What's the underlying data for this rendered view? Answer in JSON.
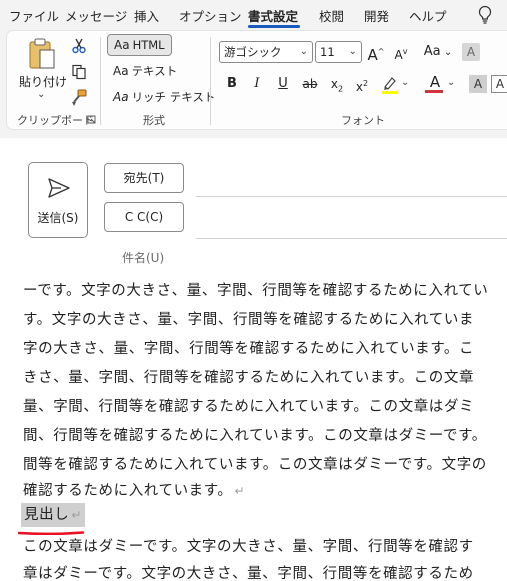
{
  "menu": {
    "tabs": [
      "ファイル",
      "メッセージ",
      "挿入",
      "オプション",
      "書式設定",
      "校閲",
      "開発",
      "ヘルプ"
    ],
    "active_tab": "書式設定"
  },
  "ribbon": {
    "clipboard": {
      "paste_label": "貼り付け",
      "group_label": "クリップボード"
    },
    "format": {
      "group_label": "形式",
      "options": [
        {
          "aa": "Aa",
          "label": "HTML",
          "selected": true
        },
        {
          "aa": "Aa",
          "label": "テキスト",
          "selected": false
        },
        {
          "aa": "Aa",
          "label": "リッチ テキスト",
          "selected": false
        }
      ]
    },
    "font": {
      "group_label": "フォント",
      "font_name": "游ゴシック",
      "font_size": "11",
      "grow": "A",
      "shrink": "A",
      "case": "Aa",
      "bold": "B",
      "italic": "I",
      "underline": "U",
      "strike": "ab",
      "subscript": "x",
      "superscript": "x",
      "sub_mark": "2",
      "super_mark": "2",
      "font_color_glyph": "A",
      "shade_glyph": "A",
      "clear_glyph": "A",
      "highlight_color": "#ffff00",
      "font_color": "#d13438"
    }
  },
  "compose": {
    "send_label": "送信(S)",
    "to_label": "宛先(T)",
    "cc_label": "C C(C)",
    "subject_label": "件名(U)",
    "body_lines": [
      "ーです。文字の大きさ、量、字間、行間等を確認するために入れてい",
      "す。文字の大きさ、量、字間、行間等を確認するために入れていま",
      "字の大きさ、量、字間、行間等を確認するために入れています。こ",
      "きさ、量、字間、行間等を確認するために入れています。この文章",
      "量、字間、行間等を確認するために入れています。この文章はダミ",
      "間、行間等を確認するために入れています。この文章はダミーです。",
      "間等を確認するために入れています。この文章はダミーです。文字の",
      "確認するために入れています。"
    ],
    "paragraph_mark": "↵",
    "heading": "見出し",
    "body_lines_after": [
      "この文章はダミーです。文字の大きさ、量、字間、行間等を確認す",
      "章はダミーです。文字の大きさ、量、字間、行間等を確認するため"
    ]
  },
  "colors": {
    "accent": "#185abd",
    "spell_error": "#e81123"
  },
  "icons": [
    "paste-icon",
    "cut-icon",
    "copy-icon",
    "format-painter-icon",
    "send-icon",
    "lightbulb-icon",
    "dialog-launcher-icon"
  ]
}
